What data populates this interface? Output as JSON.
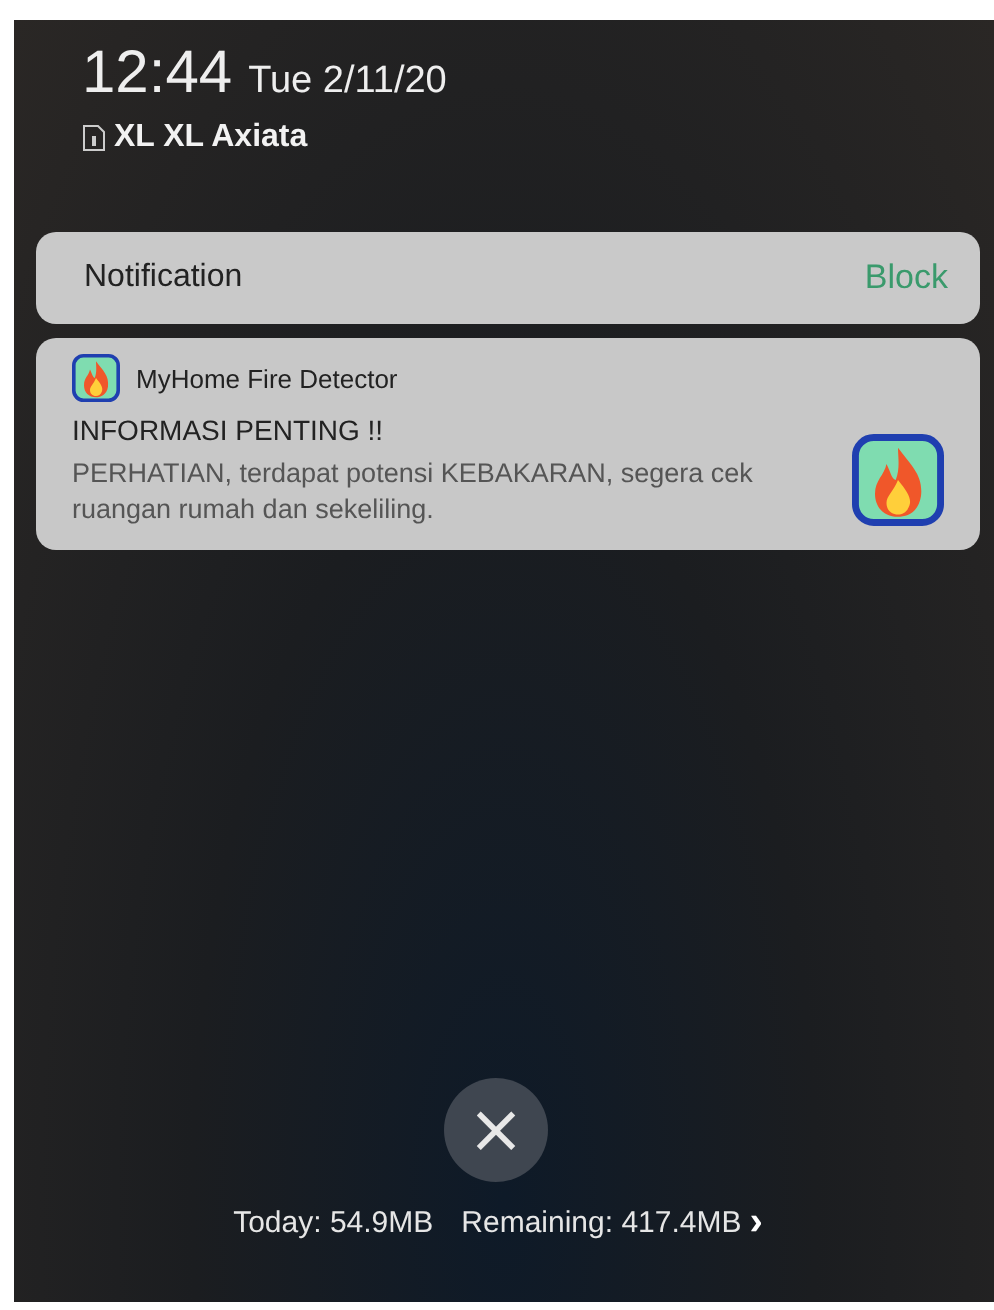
{
  "status": {
    "time": "12:44",
    "date": "Tue 2/11/20",
    "carrier": "XL XL Axiata"
  },
  "notification_header": {
    "title": "Notification",
    "action": "Block"
  },
  "notification": {
    "app_name": "MyHome Fire Detector",
    "title": "INFORMASI PENTING !!",
    "body": "PERHATIAN, terdapat potensi KEBAKARAN, segera cek ruangan rumah dan sekeliling."
  },
  "close_button": {
    "label": "×"
  },
  "data_usage": {
    "today": "Today: 54.9MB",
    "remaining": "Remaining: 417.4MB",
    "arrow": "›"
  }
}
